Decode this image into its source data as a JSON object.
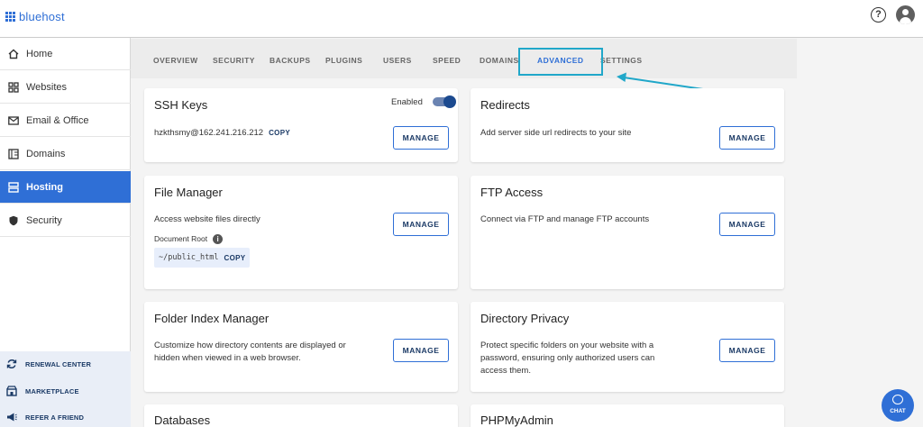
{
  "brand": {
    "name": "bluehost"
  },
  "header": {
    "help_icon": "help-circle-icon",
    "user_icon": "user-avatar-icon",
    "help_glyph": "?"
  },
  "sidebar": {
    "items": [
      {
        "label": "Home",
        "icon": "home-icon"
      },
      {
        "label": "Websites",
        "icon": "websites-icon"
      },
      {
        "label": "Email & Office",
        "icon": "mail-icon"
      },
      {
        "label": "Domains",
        "icon": "domains-icon"
      },
      {
        "label": "Hosting",
        "icon": "hosting-icon",
        "active": true
      },
      {
        "label": "Security",
        "icon": "shield-icon"
      }
    ],
    "bottom_links": [
      {
        "label": "RENEWAL CENTER",
        "icon": "renew-icon"
      },
      {
        "label": "MARKETPLACE",
        "icon": "marketplace-icon"
      },
      {
        "label": "REFER A FRIEND",
        "icon": "megaphone-icon"
      }
    ]
  },
  "tabs": [
    {
      "label": "OVERVIEW"
    },
    {
      "label": "SECURITY"
    },
    {
      "label": "BACKUPS"
    },
    {
      "label": "PLUGINS"
    },
    {
      "label": "USERS"
    },
    {
      "label": "SPEED"
    },
    {
      "label": "DOMAINS"
    },
    {
      "label": "ADVANCED",
      "active": true
    },
    {
      "label": "SETTINGS"
    }
  ],
  "cards": {
    "ssh": {
      "title": "SSH Keys",
      "toggle_label": "Enabled",
      "toggle_on": true,
      "host": "hzkthsmy@162.241.216.212",
      "copy_label": "COPY",
      "button": "MANAGE"
    },
    "redirects": {
      "title": "Redirects",
      "desc": "Add server side url redirects to your site",
      "button": "MANAGE"
    },
    "file_manager": {
      "title": "File Manager",
      "desc": "Access website files directly",
      "doc_root_label": "Document Root",
      "path": "~/public_html",
      "copy_label": "COPY",
      "button": "MANAGE",
      "info_glyph": "i"
    },
    "ftp": {
      "title": "FTP Access",
      "desc": "Connect via FTP and manage FTP accounts",
      "button": "MANAGE"
    },
    "folder_index": {
      "title": "Folder Index Manager",
      "desc_line1": "Customize how directory contents are displayed or",
      "desc_line2": "hidden when viewed in a web browser.",
      "button": "MANAGE"
    },
    "dir_privacy": {
      "title": "Directory Privacy",
      "desc_line1": "Protect specific folders on your website with a",
      "desc_line2": "password, ensuring only authorized users can",
      "desc_line3": "access them.",
      "button": "MANAGE"
    },
    "databases": {
      "title": "Databases"
    },
    "phpmyadmin": {
      "title": "PHPMyAdmin"
    }
  },
  "chat": {
    "label": "CHAT"
  },
  "colors": {
    "accent": "#2f6fd6",
    "annotation": "#20a7c9",
    "navy": "#1b3a66"
  }
}
